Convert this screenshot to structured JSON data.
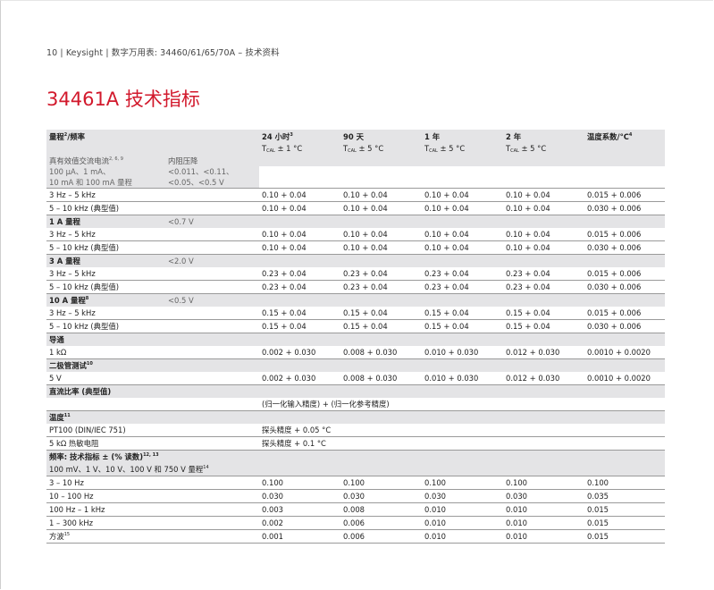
{
  "header": {
    "running_header": "10 | Keysight | 数字万用表: 34460/61/65/70A – 技术资料",
    "title": "34461A 技术指标"
  },
  "table": {
    "col_range": "量程",
    "col_range_sup": "2",
    "col_freq": "/频率",
    "col_24h": "24 小时",
    "col_24h_sup": "3",
    "col_90d": "90 天",
    "col_1y": "1 年",
    "col_2y": "2 年",
    "col_tempco": "温度系数/°C",
    "col_tempco_sup": "4",
    "tcal_t": "T",
    "tcal_sub": "CAL",
    "tcal_1": " ± 1 °C",
    "tcal_5": " ± 5 °C",
    "ac_current_label": "真有效值交流电流",
    "ac_current_sup": "2, 6, 9",
    "burden_label": "内阻压降",
    "small_ranges_line1": "100 µA、1 mA、",
    "small_ranges_line2": "10 mA 和 100 mA 量程",
    "small_burden_line1": "<0.011、<0.11、",
    "small_burden_line2": "<0.05、<0.5 V",
    "rows": [
      {
        "kind": "data",
        "label": "3 Hz – 5 kHz",
        "v": [
          "0.10 + 0.04",
          "0.10 + 0.04",
          "0.10 + 0.04",
          "0.10 + 0.04",
          "0.015 + 0.006"
        ]
      },
      {
        "kind": "data",
        "label": "5 – 10 kHz (典型值)",
        "v": [
          "0.10 + 0.04",
          "0.10 + 0.04",
          "0.10 + 0.04",
          "0.10 + 0.04",
          "0.030 + 0.006"
        ]
      },
      {
        "kind": "section",
        "label": "1 A 量程",
        "sup": "",
        "extra": "<0.7 V"
      },
      {
        "kind": "data",
        "label": "3 Hz – 5 kHz",
        "v": [
          "0.10 + 0.04",
          "0.10 + 0.04",
          "0.10 + 0.04",
          "0.10 + 0.04",
          "0.015 + 0.006"
        ]
      },
      {
        "kind": "data",
        "label": "5 – 10 kHz (典型值)",
        "v": [
          "0.10 + 0.04",
          "0.10 + 0.04",
          "0.10 + 0.04",
          "0.10 + 0.04",
          "0.030 + 0.006"
        ]
      },
      {
        "kind": "section",
        "label": "3 A 量程",
        "sup": "",
        "extra": "<2.0 V"
      },
      {
        "kind": "data",
        "label": "3 Hz – 5 kHz",
        "v": [
          "0.23 + 0.04",
          "0.23 + 0.04",
          "0.23 + 0.04",
          "0.23 + 0.04",
          "0.015 + 0.006"
        ]
      },
      {
        "kind": "data",
        "label": "5 – 10 kHz (典型值)",
        "v": [
          "0.23 + 0.04",
          "0.23 + 0.04",
          "0.23 + 0.04",
          "0.23 + 0.04",
          "0.030 + 0.006"
        ]
      },
      {
        "kind": "section",
        "label": "10 A 量程",
        "sup": "8",
        "extra": "<0.5 V"
      },
      {
        "kind": "data",
        "label": "3 Hz – 5 kHz",
        "v": [
          "0.15 + 0.04",
          "0.15 + 0.04",
          "0.15 + 0.04",
          "0.15 + 0.04",
          "0.015 + 0.006"
        ]
      },
      {
        "kind": "data",
        "label": "5 – 10 kHz (典型值)",
        "v": [
          "0.15 + 0.04",
          "0.15 + 0.04",
          "0.15 + 0.04",
          "0.15 + 0.04",
          "0.030 + 0.006"
        ]
      },
      {
        "kind": "section",
        "label": "导通",
        "sup": "",
        "extra": ""
      },
      {
        "kind": "data",
        "label": "1 kΩ",
        "v": [
          "0.002 + 0.030",
          "0.008 + 0.030",
          "0.010 + 0.030",
          "0.012 + 0.030",
          "0.0010 + 0.0020"
        ]
      },
      {
        "kind": "section",
        "label": "二极管测试",
        "sup": "10",
        "extra": ""
      },
      {
        "kind": "data",
        "label": "5 V",
        "v": [
          "0.002 + 0.030",
          "0.008 + 0.030",
          "0.010 + 0.030",
          "0.012 + 0.030",
          "0.0010 + 0.0020"
        ]
      },
      {
        "kind": "section",
        "label": "直流比率 (典型值)",
        "sup": "",
        "extra": ""
      },
      {
        "kind": "note",
        "text": "(归一化输入精度) + (归一化参考精度)"
      },
      {
        "kind": "section",
        "label": "温度",
        "sup": "11",
        "extra": ""
      },
      {
        "kind": "single",
        "label": "PT100 (DIN/IEC 751)",
        "value": "探头精度 + 0.05 °C"
      },
      {
        "kind": "single",
        "label": "5 kΩ 热敏电阻",
        "value": "探头精度 + 0.1 °C"
      },
      {
        "kind": "section2",
        "label": "频率: 技术指标 ± (% 读数)",
        "sup": "12, 13",
        "line2": "100 mV、1 V、10 V、100 V 和 750 V 量程",
        "line2_sup": "14"
      },
      {
        "kind": "data",
        "label": "3 – 10 Hz",
        "v": [
          "0.100",
          "0.100",
          "0.100",
          "0.100",
          "0.100"
        ]
      },
      {
        "kind": "data",
        "label": "10 – 100 Hz",
        "v": [
          "0.030",
          "0.030",
          "0.030",
          "0.030",
          "0.035"
        ]
      },
      {
        "kind": "data",
        "label": "100 Hz – 1 kHz",
        "v": [
          "0.003",
          "0.008",
          "0.010",
          "0.010",
          "0.015"
        ]
      },
      {
        "kind": "data",
        "label": "1 – 300 kHz",
        "v": [
          "0.002",
          "0.006",
          "0.010",
          "0.010",
          "0.015"
        ]
      },
      {
        "kind": "data",
        "label": "方波",
        "sup": "15",
        "v": [
          "0.001",
          "0.006",
          "0.010",
          "0.010",
          "0.015"
        ]
      }
    ]
  }
}
